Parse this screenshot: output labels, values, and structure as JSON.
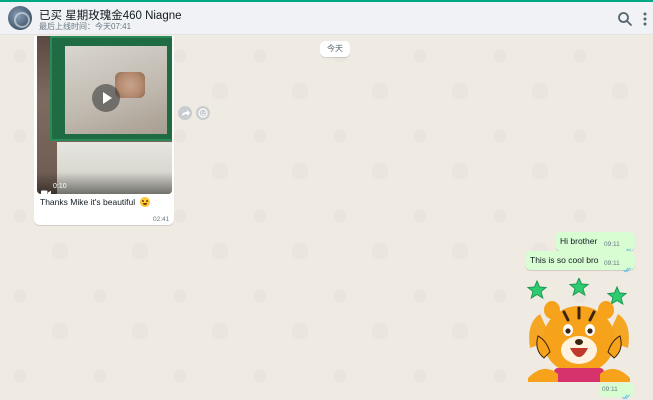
{
  "header": {
    "contact_name": "已买 星期玫瑰金460 Niagne",
    "last_seen": "最后上线时间：今天07:41",
    "search_icon": "search-icon",
    "menu_icon": "more-vertical-icon"
  },
  "chat": {
    "date_chip": "今天",
    "incoming_message": {
      "media_type": "video",
      "video_duration": "0:10",
      "caption": "Thanks Mike it's beautiful",
      "time": "02:41",
      "play_icon": "play-icon",
      "camera_icon": "video-camera-icon",
      "emoji": "star-struck-emoji"
    },
    "hover_actions": {
      "forward_icon": "forward-icon",
      "reaction_icon": "emoji-reaction-icon"
    },
    "outgoing_messages": [
      {
        "text": "Hi brother",
        "time": "09:11",
        "status": "read"
      },
      {
        "text": "This is so cool bro",
        "time": "09:11",
        "status": "read"
      }
    ],
    "sticker": {
      "description": "tiger-with-stars-sticker",
      "time": "09:11",
      "status": "read"
    }
  },
  "colors": {
    "accent": "#00a884",
    "outgoing_bubble": "#d9fdd3",
    "incoming_bubble": "#ffffff",
    "chat_background": "#efeae2",
    "read_ticks": "#53bdeb",
    "header_background": "#f0f2f5"
  }
}
